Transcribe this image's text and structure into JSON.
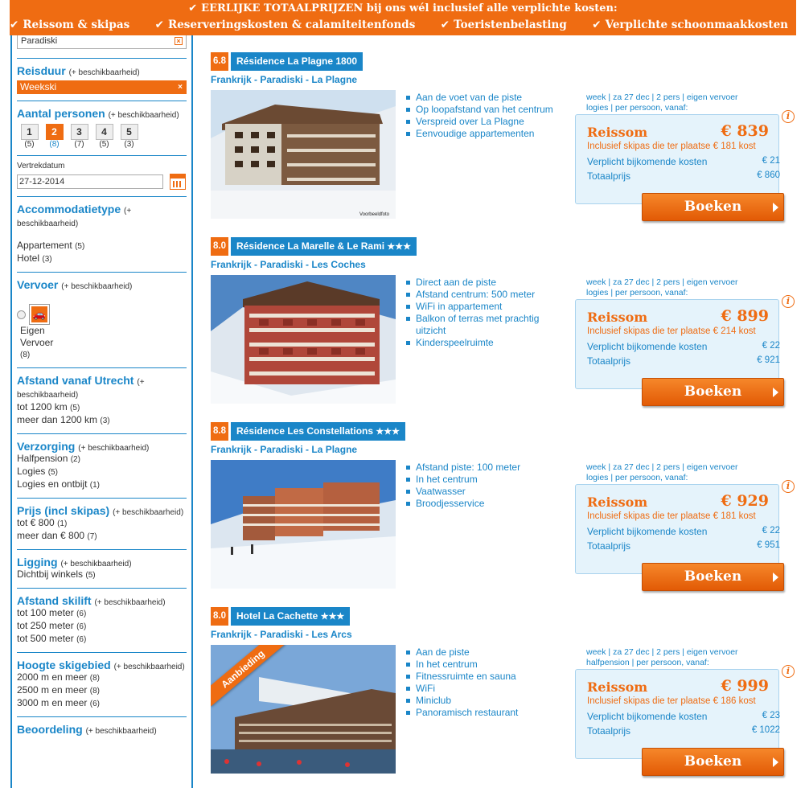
{
  "banner": {
    "headline": "EERLIJKE TOTAALPRIJZEN bij ons wél inclusief alle verplichte kosten:",
    "items": [
      "Reissom & skipas",
      "Reserveringskosten & calamiteitenfonds",
      "Toeristenbelasting",
      "Verplichte schoonmaakkosten"
    ],
    "check_icon": "checkmark-icon"
  },
  "sidebar": {
    "search_value": "Paradiski",
    "duration": {
      "title": "Reisduur",
      "sub": "(+ beschikbaarheid)",
      "chip": "Weekski"
    },
    "persons": {
      "title": "Aantal personen",
      "sub": "(+ beschikbaarheid)",
      "options": [
        {
          "n": "1",
          "count": "(5)"
        },
        {
          "n": "2",
          "count": "(8)"
        },
        {
          "n": "3",
          "count": "(7)"
        },
        {
          "n": "4",
          "count": "(5)"
        },
        {
          "n": "5",
          "count": "(3)"
        }
      ]
    },
    "date": {
      "label": "Vertrekdatum",
      "value": "27-12-2014"
    },
    "accommodation": {
      "title": "Accommodatietype",
      "sub": "(+ beschikbaarheid)",
      "items": [
        {
          "label": "Appartement",
          "count": "(5)"
        },
        {
          "label": "Hotel",
          "count": "(3)"
        }
      ]
    },
    "transport": {
      "title": "Vervoer",
      "sub": "(+ beschikbaarheid)",
      "label1": "Eigen",
      "label2": "Vervoer",
      "count": "(8)"
    },
    "distance": {
      "title": "Afstand vanaf Utrecht",
      "sub": "(+ beschikbaarheid)",
      "items": [
        {
          "label": "tot 1200 km",
          "count": "(5)"
        },
        {
          "label": "meer dan 1200 km",
          "count": "(3)"
        }
      ]
    },
    "board": {
      "title": "Verzorging",
      "sub": "(+ beschikbaarheid)",
      "items": [
        {
          "label": "Halfpension",
          "count": "(2)"
        },
        {
          "label": "Logies",
          "count": "(5)"
        },
        {
          "label": "Logies en ontbijt",
          "count": "(1)"
        }
      ]
    },
    "price": {
      "title": "Prijs (incl skipas)",
      "sub": "(+ beschikbaarheid)",
      "items": [
        {
          "label": "tot € 800",
          "count": "(1)"
        },
        {
          "label": "meer dan € 800",
          "count": "(7)"
        }
      ]
    },
    "location": {
      "title": "Ligging",
      "sub": "(+ beschikbaarheid)",
      "items": [
        {
          "label": "Dichtbij winkels",
          "count": "(5)"
        }
      ]
    },
    "skilift": {
      "title": "Afstand skilift",
      "sub": "(+ beschikbaarheid)",
      "items": [
        {
          "label": "tot 100 meter",
          "count": "(6)"
        },
        {
          "label": "tot 250 meter",
          "count": "(6)"
        },
        {
          "label": "tot 500 meter",
          "count": "(6)"
        }
      ]
    },
    "altitude": {
      "title": "Hoogte skigebied",
      "sub": "(+ beschikbaarheid)",
      "items": [
        {
          "label": "2000 m en meer",
          "count": "(8)"
        },
        {
          "label": "2500 m en meer",
          "count": "(8)"
        },
        {
          "label": "3000 m en meer",
          "count": "(6)"
        }
      ]
    },
    "rating": {
      "title": "Beoordeling",
      "sub": "(+ beschikbaarheid)"
    }
  },
  "listings": [
    {
      "score": "6.8",
      "name": "Résidence La Plagne 1800",
      "stars": "",
      "location": "Frankrijk - Paradiski - La Plagne",
      "features": [
        "Aan de voet van de piste",
        "Op loopafstand van het centrum",
        "Verspreid over La Plagne",
        "Eenvoudige appartementen"
      ],
      "meta1": "week | za 27 dec | 2 pers | eigen vervoer",
      "meta2": "logies | per persoon, vanaf:",
      "reissom_label": "Reissom",
      "reissom": "€ 839",
      "skipas": "Inclusief skipas die ter plaatse € 181 kost",
      "extra_label": "Verplicht bijkomende kosten",
      "extra": "€ 21",
      "total_label": "Totaalprijs",
      "total": "€ 860",
      "book": "Boeken",
      "watermark": "Voorbeeldfoto",
      "ribbon": ""
    },
    {
      "score": "8.0",
      "name": "Résidence La Marelle & Le Rami",
      "stars": "★★★",
      "location": "Frankrijk - Paradiski - Les Coches",
      "features": [
        "Direct aan de piste",
        "Afstand centrum: 500 meter",
        "WiFi in appartement",
        "Balkon of terras met prachtig uitzicht",
        "Kinderspeelruimte"
      ],
      "meta1": "week | za 27 dec | 2 pers | eigen vervoer",
      "meta2": "logies | per persoon, vanaf:",
      "reissom_label": "Reissom",
      "reissom": "€ 899",
      "skipas": "Inclusief skipas die ter plaatse € 214 kost",
      "extra_label": "Verplicht bijkomende kosten",
      "extra": "€ 22",
      "total_label": "Totaalprijs",
      "total": "€ 921",
      "book": "Boeken",
      "watermark": "",
      "ribbon": ""
    },
    {
      "score": "8.8",
      "name": "Résidence Les Constellations",
      "stars": "★★★",
      "location": "Frankrijk - Paradiski - La Plagne",
      "features": [
        "Afstand piste: 100 meter",
        "In het centrum",
        "Vaatwasser",
        "Broodjesservice"
      ],
      "meta1": "week | za 27 dec | 2 pers | eigen vervoer",
      "meta2": "logies | per persoon, vanaf:",
      "reissom_label": "Reissom",
      "reissom": "€ 929",
      "skipas": "Inclusief skipas die ter plaatse € 181 kost",
      "extra_label": "Verplicht bijkomende kosten",
      "extra": "€ 22",
      "total_label": "Totaalprijs",
      "total": "€ 951",
      "book": "Boeken",
      "watermark": "",
      "ribbon": ""
    },
    {
      "score": "8.0",
      "name": "Hotel La Cachette",
      "stars": "★★★",
      "location": "Frankrijk - Paradiski - Les Arcs",
      "features": [
        "Aan de piste",
        "In het centrum",
        "Fitnessruimte en sauna",
        "WiFi",
        "Miniclub",
        "Panoramisch restaurant"
      ],
      "meta1": "week | za 27 dec | 2 pers | eigen vervoer",
      "meta2": "halfpension | per persoon, vanaf:",
      "reissom_label": "Reissom",
      "reissom": "€ 999",
      "skipas": "Inclusief skipas die ter plaatse € 186 kost",
      "extra_label": "Verplicht bijkomende kosten",
      "extra": "€ 23",
      "total_label": "Totaalprijs",
      "total": "€ 1022",
      "book": "Boeken",
      "watermark": "",
      "ribbon": "Aanbieding"
    }
  ],
  "colors": {
    "accent_orange": "#ef6c12",
    "brand_blue": "#1a86c8",
    "price_panel": "#e5f3fb"
  }
}
